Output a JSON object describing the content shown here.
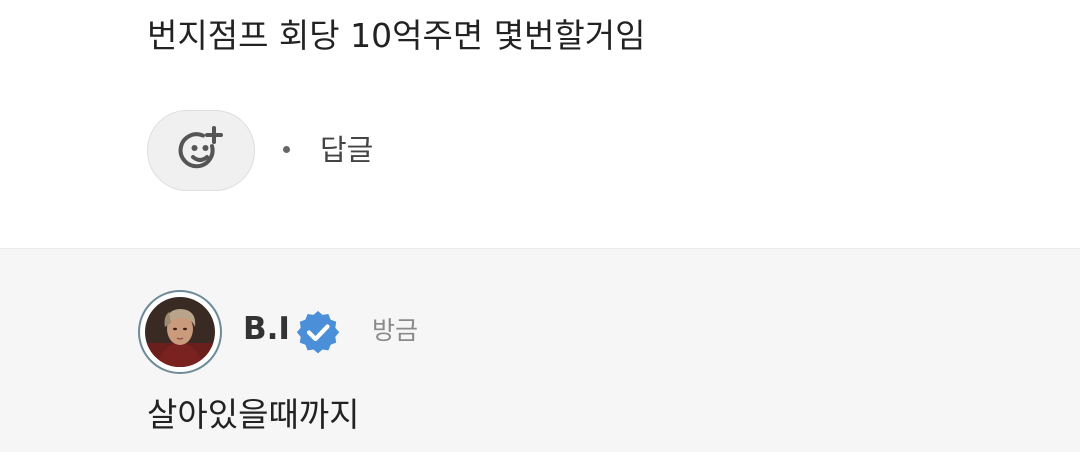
{
  "comment": {
    "text": "번지점프 회당 10억주면 몇번할거임",
    "reaction_icon": "add-emoji-icon",
    "reply_label": "답글"
  },
  "reply": {
    "author": "B.I",
    "verified_icon": "verified-badge-icon",
    "timestamp": "방금",
    "text": "살아있을때까지"
  },
  "colors": {
    "background": "#ffffff",
    "reply_background": "#f6f6f6",
    "text": "#222222",
    "muted": "#8a8a8a",
    "verified": "#4a8fd8",
    "avatar_ring": "#6d8a99"
  }
}
